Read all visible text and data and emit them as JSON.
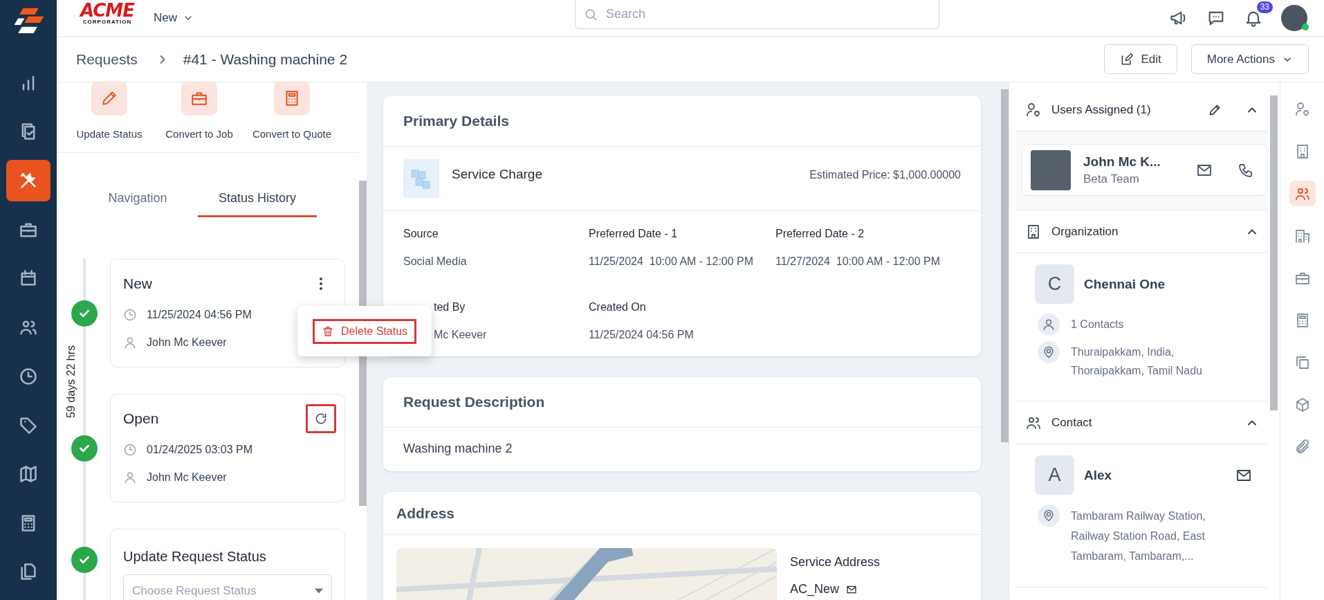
{
  "top_bar": {
    "logo": {
      "name": "ACME",
      "tagline": "CORPORATION"
    },
    "workspace_menu": "New",
    "search": {
      "placeholder": "Search"
    },
    "notification_count": "33",
    "user_online": true
  },
  "side_nav": {
    "items": [
      {
        "selected": false
      },
      {
        "selected": false
      },
      {
        "selected": true
      },
      {
        "selected": false
      },
      {
        "selected": false
      },
      {
        "selected": false
      },
      {
        "selected": false
      },
      {
        "selected": false
      },
      {
        "selected": false
      },
      {
        "selected": false
      },
      {
        "selected": false
      }
    ]
  },
  "breadcrumb": [
    "Requests",
    "#41 - Washing machine 2"
  ],
  "header_buttons": [
    {
      "kind": "edit",
      "label": "Edit"
    },
    {
      "kind": "menu",
      "label": "More Actions"
    }
  ],
  "quick_actions": [
    {
      "label": "Update Status"
    },
    {
      "label": "Convert to Job"
    },
    {
      "label": "Convert to Quote"
    }
  ],
  "tabs": [
    {
      "label": "Navigation",
      "selected": false
    },
    {
      "label": "Status History",
      "selected": true
    }
  ],
  "status_history": {
    "duration": "59 days 22 hrs",
    "entries": [
      {
        "kind": "menu",
        "status": "New",
        "time": "11/25/2024 04:56 PM",
        "user": "John Mc Keever",
        "completed": true,
        "menu_open": true,
        "highlighted": false
      },
      {
        "kind": "revert",
        "status": "Open",
        "time": "01/24/2025 03:03 PM",
        "user": "John Mc Keever",
        "completed": true,
        "menu_open": false,
        "highlighted": true
      }
    ],
    "update_form": {
      "title": "Update Request Status",
      "placeholder": "Choose Request Status",
      "completed": true
    }
  },
  "context_menu": {
    "items": [
      {
        "label": "Delete Status",
        "highlighted": true
      }
    ]
  },
  "primary_details": {
    "title": "Primary Details",
    "service": {
      "name": "Service Charge",
      "price": "Estimated Price: $1,000.00000"
    },
    "fields": [
      {
        "label": "Source",
        "value": "Social Media",
        "partly_hidden": false
      },
      {
        "label": "Preferred Date - 1",
        "value": "11/25/2024  10:00 AM - 12:00 PM",
        "partly_hidden": false
      },
      {
        "label": "Preferred Date - 2",
        "value": "11/27/2024  10:00 AM - 12:00 PM",
        "partly_hidden": false
      },
      {
        "label": "ted By",
        "value": "Mc Keever",
        "partly_hidden": true
      },
      {
        "label": "Created On",
        "value": "11/25/2024 04:56 PM",
        "partly_hidden": false
      }
    ]
  },
  "request_description": {
    "title": "Request Description",
    "text": "Washing machine 2"
  },
  "address": {
    "title": "Address",
    "service_address_label": "Service Address",
    "service_address": "AC_New"
  },
  "assignment_panel": {
    "users": {
      "title": "Users Assigned (1)",
      "expanded": true,
      "people": [
        {
          "name": "John Mc K...",
          "team": "Beta Team"
        }
      ]
    },
    "organization": {
      "title": "Organization",
      "expanded": true,
      "initial": "C",
      "name": "Chennai One",
      "contacts": "1 Contacts",
      "address": "Thuraipakkam, India, Thoraipakkam, Tamil Nadu"
    },
    "contact": {
      "title": "Contact",
      "expanded": true,
      "initial": "A",
      "name": "Alex",
      "address": "Tambaram Railway Station, Railway Station Road, East Tambaram, Tambaram,..."
    }
  },
  "right_rail": {
    "items": [
      {
        "selected": false
      },
      {
        "selected": false
      },
      {
        "selected": true
      },
      {
        "selected": false
      },
      {
        "selected": false
      },
      {
        "selected": false
      },
      {
        "selected": false
      },
      {
        "selected": false
      },
      {
        "selected": false
      }
    ]
  }
}
